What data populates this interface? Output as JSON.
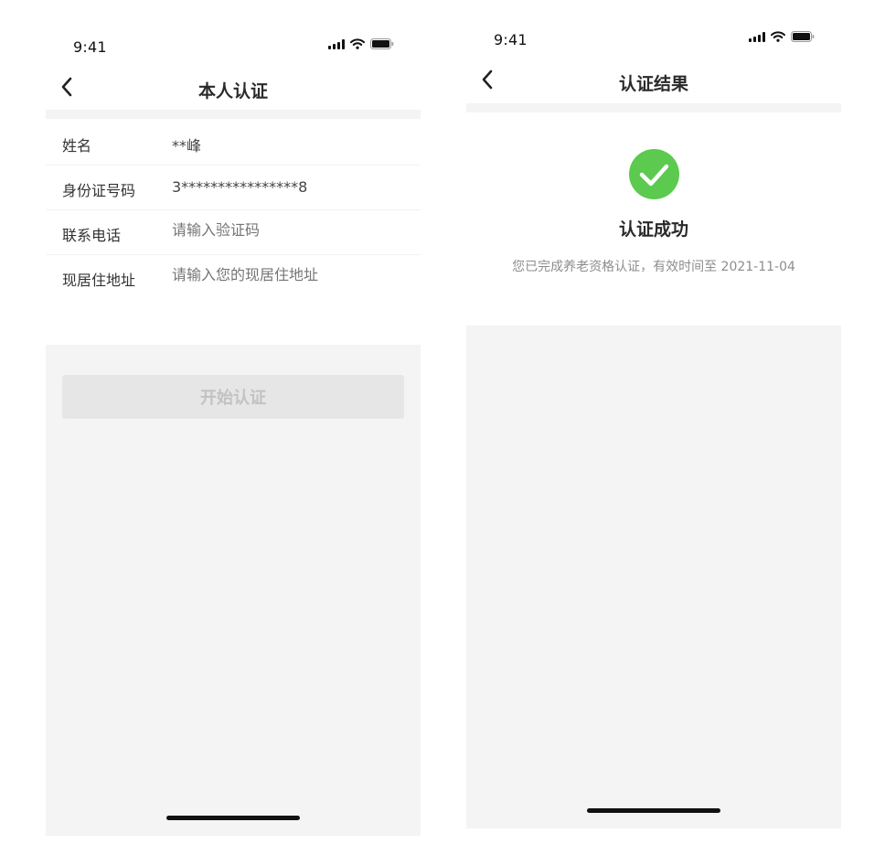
{
  "status_bar": {
    "time": "9:41"
  },
  "left_screen": {
    "title": "本人认证",
    "form": [
      {
        "label": "姓名",
        "value": "**峰"
      },
      {
        "label": "身份证号码",
        "value": "3****************8"
      },
      {
        "label": "联系电话",
        "placeholder": "请输入验证码"
      },
      {
        "label": "现居住地址",
        "placeholder": "请输入您的现居住地址"
      }
    ],
    "start_button": "开始认证"
  },
  "right_screen": {
    "title": "认证结果",
    "result_title": "认证成功",
    "result_message": "您已完成养老资格认证，有效时间至 2021-11-04"
  },
  "colors": {
    "success_green": "#5bca4f",
    "page_gray": "#f4f4f5",
    "button_disabled": "#e6e6e7",
    "placeholder_text": "#b5b5b5"
  },
  "icons": [
    "back-chevron-icon",
    "signal-icon",
    "wifi-icon",
    "battery-icon",
    "check-icon"
  ]
}
